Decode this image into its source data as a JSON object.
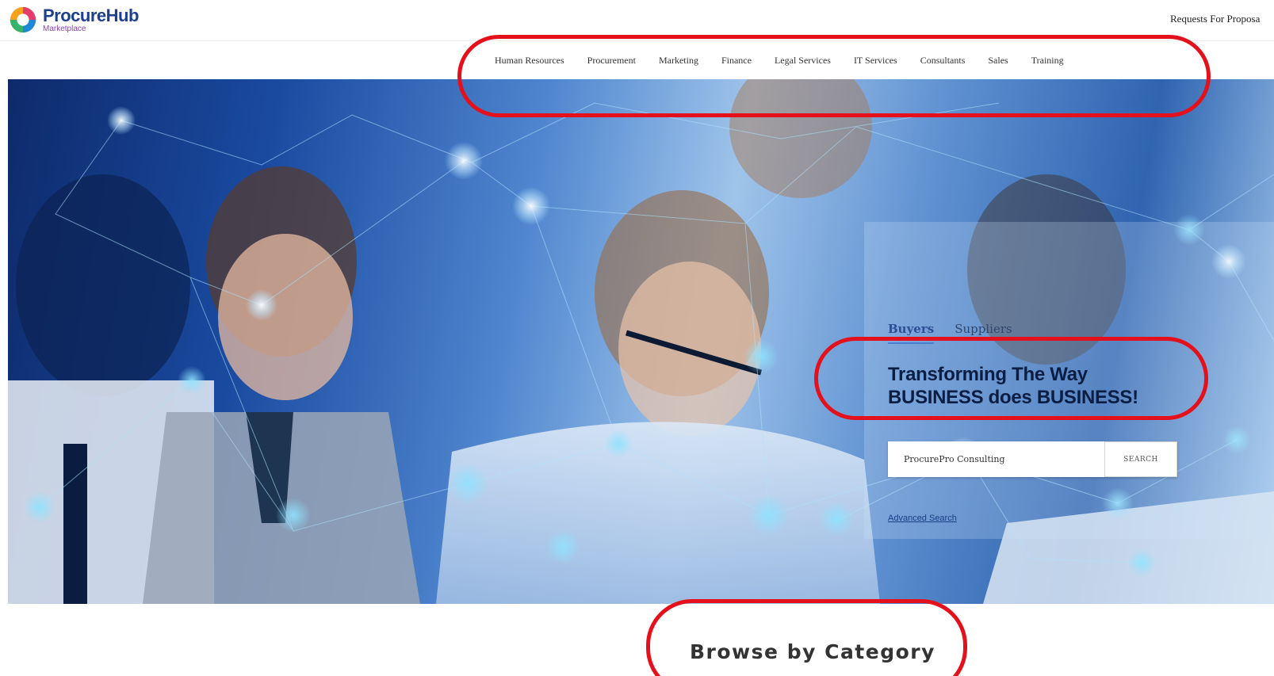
{
  "brand": {
    "name_part1": "Procure",
    "name_part2": "Hub",
    "subtitle": "Marketplace"
  },
  "header": {
    "top_link": "Requests For Proposa"
  },
  "nav": {
    "items": [
      "Human Resources",
      "Procurement",
      "Marketing",
      "Finance",
      "Legal Services",
      "IT Services",
      "Consultants",
      "Sales",
      "Training"
    ]
  },
  "hero": {
    "tabs": [
      {
        "label": "Buyers",
        "active": true
      },
      {
        "label": "Suppliers",
        "active": false
      }
    ],
    "tagline_line1": "Transforming The Way",
    "tagline_line2": "BUSINESS does BUSINESS!",
    "search": {
      "value": "ProcurePro Consulting",
      "button_label": "SEARCH"
    },
    "advanced_search": "Advanced Search"
  },
  "browse": {
    "title": "Browse by Category"
  },
  "colors": {
    "brand_blue": "#1d3f8f",
    "annotation_red": "#e4101b",
    "active_tab": "#2d4f96"
  }
}
